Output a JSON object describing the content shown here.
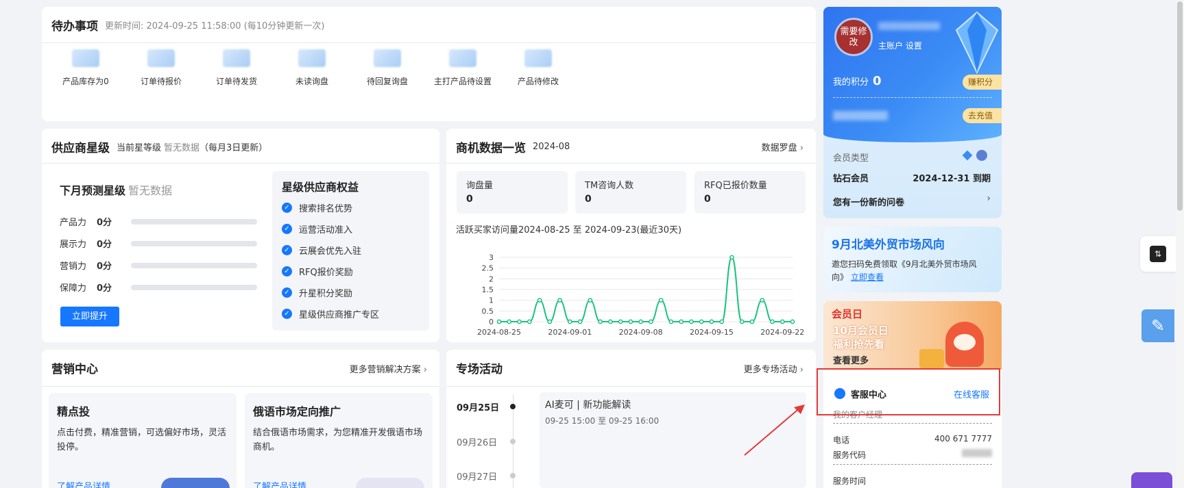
{
  "todo": {
    "title": "待办事项",
    "updated": "更新时间: 2024-09-25 11:58:00 (每10分钟更新一次)",
    "items": [
      "产品库存为0",
      "订单待报价",
      "订单待发货",
      "未读询盘",
      "待回复询盘",
      "主打产品待设置",
      "产品待修改"
    ]
  },
  "supplier_star": {
    "title": "供应商星级",
    "level_label": "当前星等级",
    "level_value": "暂无数据",
    "update_note": "（每月3日更新）",
    "forecast_label": "下月预测星级",
    "forecast_value": "暂无数据",
    "scores": [
      {
        "label": "产品力",
        "value": "0分"
      },
      {
        "label": "展示力",
        "value": "0分"
      },
      {
        "label": "营销力",
        "value": "0分"
      },
      {
        "label": "保障力",
        "value": "0分"
      }
    ],
    "button": "立即提升",
    "benefits_title": "星级供应商权益",
    "benefits": [
      "搜索排名优势",
      "运营活动准入",
      "云展会优先入驻",
      "RFQ报价奖励",
      "升星积分奖励",
      "星级供应商推广专区"
    ]
  },
  "biz_data": {
    "title": "商机数据一览",
    "month": "2024-08",
    "link": "数据罗盘",
    "stats": [
      {
        "label": "询盘量",
        "value": "0"
      },
      {
        "label": "TM咨询人数",
        "value": "0"
      },
      {
        "label": "RFQ已报价数量",
        "value": "0"
      }
    ],
    "chart_title": "活跃买家访问量2024-08-25 至 2024-09-23(最近30天)"
  },
  "chart_data": {
    "type": "line",
    "title": "活跃买家访问量2024-08-25 至 2024-09-23(最近30天)",
    "x": [
      "2024-08-25",
      "2024-08-26",
      "2024-08-27",
      "2024-08-28",
      "2024-08-29",
      "2024-08-30",
      "2024-08-31",
      "2024-09-01",
      "2024-09-02",
      "2024-09-03",
      "2024-09-04",
      "2024-09-05",
      "2024-09-06",
      "2024-09-07",
      "2024-09-08",
      "2024-09-09",
      "2024-09-10",
      "2024-09-11",
      "2024-09-12",
      "2024-09-13",
      "2024-09-14",
      "2024-09-15",
      "2024-09-16",
      "2024-09-17",
      "2024-09-18",
      "2024-09-19",
      "2024-09-20",
      "2024-09-21",
      "2024-09-22",
      "2024-09-23"
    ],
    "series": [
      {
        "values": [
          0,
          0,
          0,
          0,
          1,
          0,
          1,
          0,
          0,
          1,
          0,
          0,
          0,
          0,
          0,
          0,
          1,
          0,
          0,
          0,
          0,
          0,
          0,
          3,
          0,
          0,
          1,
          0,
          0,
          0
        ],
        "color": "#19c37d"
      }
    ],
    "x_ticks": [
      "2024-08-25",
      "2024-09-01",
      "2024-09-08",
      "2024-09-15",
      "2024-09-22"
    ],
    "y_ticks": [
      "0",
      "0.5",
      "1",
      "1.5",
      "2",
      "2.5",
      "3"
    ],
    "ylim": [
      0,
      3
    ],
    "grid": true
  },
  "marketing": {
    "title": "营销中心",
    "link": "更多营销解决方案",
    "cards": [
      {
        "title": "精点投",
        "desc": "点击付费，精准营销，可选偏好市场，灵活投停。",
        "link": "了解产品详情"
      },
      {
        "title": "俄语市场定向推广",
        "desc": "结合俄语市场需求，为您精准开发俄语市场商机。",
        "link": "了解产品详情"
      }
    ]
  },
  "activity": {
    "title": "专场活动",
    "link": "更多专场活动",
    "dates": [
      "09月25日",
      "09月26日",
      "09月27日"
    ],
    "event_title": "AI麦可 | 新功能解读",
    "event_time": "09-25 15:00 至 09-25 16:00"
  },
  "account": {
    "avatar_text": "需要修改",
    "main_account": "主账户 设置",
    "points_label": "我的积分",
    "points_value": "0",
    "earn_button": "赚积分",
    "recharge_button": "去充值",
    "member_type_label": "会员类型",
    "member_level": "钻石会员",
    "expiry": "2024-12-31 到期",
    "survey": "您有一份新的问卷"
  },
  "promo1": {
    "title": "9月北美外贸市场风向",
    "desc": "邀您扫码免费领取《9月北美外贸市场风向》",
    "link": "立即查看"
  },
  "promo2": {
    "badge": "会员日",
    "line1": "10月会员日",
    "line2": "福利抢先看",
    "link": "查看更多"
  },
  "service": {
    "title": "客服中心",
    "online": "在线客服",
    "manager": "我的客户经理",
    "phone_label": "电话",
    "phone": "400 671 7777",
    "code_label": "服务代码",
    "hours_label": "服务时间"
  },
  "colors": {
    "accent": "#1677ff",
    "chart_line": "#19c37d",
    "highlight": "#e53935"
  }
}
